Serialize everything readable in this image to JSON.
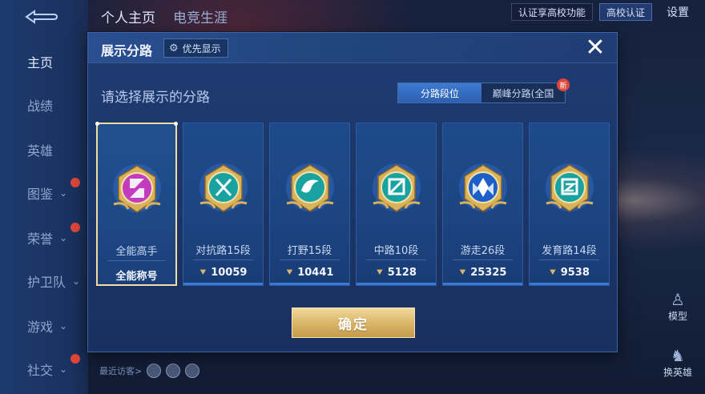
{
  "background": {
    "back_icon": "back-arrow-icon",
    "top_tabs": [
      "个人主页",
      "电竞生涯"
    ],
    "nav_items": [
      {
        "label": "主页",
        "active": true,
        "chevron": false,
        "new": false
      },
      {
        "label": "战绩",
        "active": false,
        "chevron": false,
        "new": false
      },
      {
        "label": "英雄",
        "active": false,
        "chevron": false,
        "new": false
      },
      {
        "label": "图鉴",
        "active": false,
        "chevron": true,
        "new": true
      },
      {
        "label": "荣誉",
        "active": false,
        "chevron": true,
        "new": true
      },
      {
        "label": "护卫队",
        "active": false,
        "chevron": true,
        "new": false
      },
      {
        "label": "游戏",
        "active": false,
        "chevron": true,
        "new": false
      },
      {
        "label": "社交",
        "active": false,
        "chevron": true,
        "new": true
      }
    ],
    "top_right": {
      "campus_text": "认证享高校功能",
      "campus_badge": "高校认证",
      "settings": "设置"
    },
    "right_buttons": [
      {
        "label": "模型",
        "icon": "person-model-icon"
      },
      {
        "label": "换英雄",
        "icon": "swap-hero-icon"
      }
    ],
    "recent_visitors": "最近访客>"
  },
  "modal": {
    "title": "展示分路",
    "priority_label": "优先显示",
    "priority_icon": "gear-icon",
    "close_icon": "close-icon",
    "subtitle": "请选择展示的分路",
    "segments": [
      {
        "label": "分路段位",
        "active": true
      },
      {
        "label": "巅峰分路(全国",
        "active": false,
        "new_tag": "新"
      }
    ],
    "cards": [
      {
        "name": "全能高手",
        "stat": "全能称号",
        "is_title": true,
        "selected": true,
        "emblem": "all-round-emblem-icon",
        "color": "#c23cc0"
      },
      {
        "name": "对抗路15段",
        "stat": "10059",
        "is_title": false,
        "selected": false,
        "emblem": "clash-lane-emblem-icon",
        "color": "#19a3a0"
      },
      {
        "name": "打野15段",
        "stat": "10441",
        "is_title": false,
        "selected": false,
        "emblem": "jungle-emblem-icon",
        "color": "#19a3a0"
      },
      {
        "name": "中路10段",
        "stat": "5128",
        "is_title": false,
        "selected": false,
        "emblem": "mid-lane-emblem-icon",
        "color": "#19a3a0"
      },
      {
        "name": "游走26段",
        "stat": "25325",
        "is_title": false,
        "selected": false,
        "emblem": "roam-emblem-icon",
        "color": "#1d5fc9"
      },
      {
        "name": "发育路14段",
        "stat": "9538",
        "is_title": false,
        "selected": false,
        "emblem": "farm-lane-emblem-icon",
        "color": "#19a3a0"
      }
    ],
    "stat_icon": "rank-arrow-icon",
    "confirm_label": "确定"
  }
}
